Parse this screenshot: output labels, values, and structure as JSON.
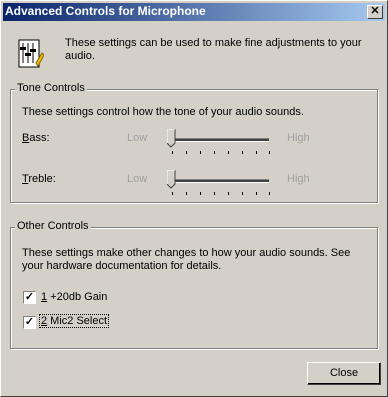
{
  "window": {
    "title": "Advanced Controls for Microphone",
    "close_glyph": "✕"
  },
  "intro": {
    "text": "These settings can be used to make fine adjustments to your audio.",
    "icon": "mixer-icon"
  },
  "tone": {
    "title": "Tone Controls",
    "description": "These settings control how the tone of your audio sounds.",
    "bass": {
      "label_key": "B",
      "label_rest": "ass:",
      "low": "Low",
      "high": "High",
      "level": 0.0
    },
    "treble": {
      "label_key": "T",
      "label_rest": "reble:",
      "low": "Low",
      "high": "High",
      "level": 0.0
    }
  },
  "other": {
    "title": "Other Controls",
    "description": "These settings make other changes to how your audio sounds.  See your hardware documentation for details.",
    "options": [
      {
        "key": "1",
        "label": " +20db Gain",
        "checked": true
      },
      {
        "key": "2",
        "label": " Mic2 Select",
        "checked": true
      }
    ]
  },
  "buttons": {
    "close": "Close"
  },
  "check_mark": "✓"
}
